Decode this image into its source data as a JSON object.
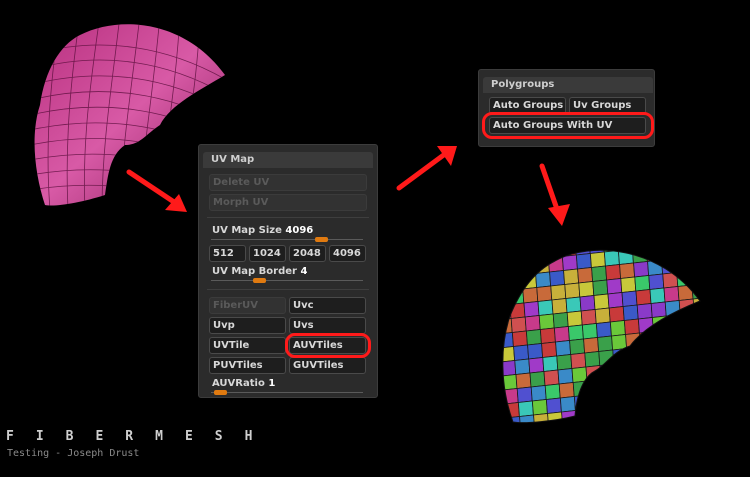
{
  "uv_panel": {
    "title": "UV Map",
    "delete_uv": "Delete UV",
    "morph_uv": "Morph UV",
    "map_size_label": "UV Map Size",
    "map_size_value": "4096",
    "map_size_level": 0.75,
    "sizes": [
      "512",
      "1024",
      "2048",
      "4096"
    ],
    "border_label": "UV Map Border",
    "border_value": "4",
    "border_level": 0.3,
    "fiber_uv": "FiberUV",
    "uvc": "Uvc",
    "uvp": "Uvp",
    "uvs": "Uvs",
    "uvtile": "UVTile",
    "auvtiles": "AUVTiles",
    "puvtiles": "PUVTiles",
    "guvtiles": "GUVTiles",
    "ratio_label": "AUVRatio",
    "ratio_value": "1",
    "ratio_level": 0.02
  },
  "polygroups_panel": {
    "title": "Polygroups",
    "auto_groups": "Auto Groups",
    "uv_groups": "Uv Groups",
    "auto_groups_with_uv": "Auto Groups With UV"
  },
  "footer": {
    "title": "FIBERMESH",
    "subtitle": "Testing - Joseph Drust"
  },
  "colors": {
    "highlight": "#ff1a1a",
    "slider_knob": "#e07a10",
    "mesh_magenta": "#c0308a"
  }
}
